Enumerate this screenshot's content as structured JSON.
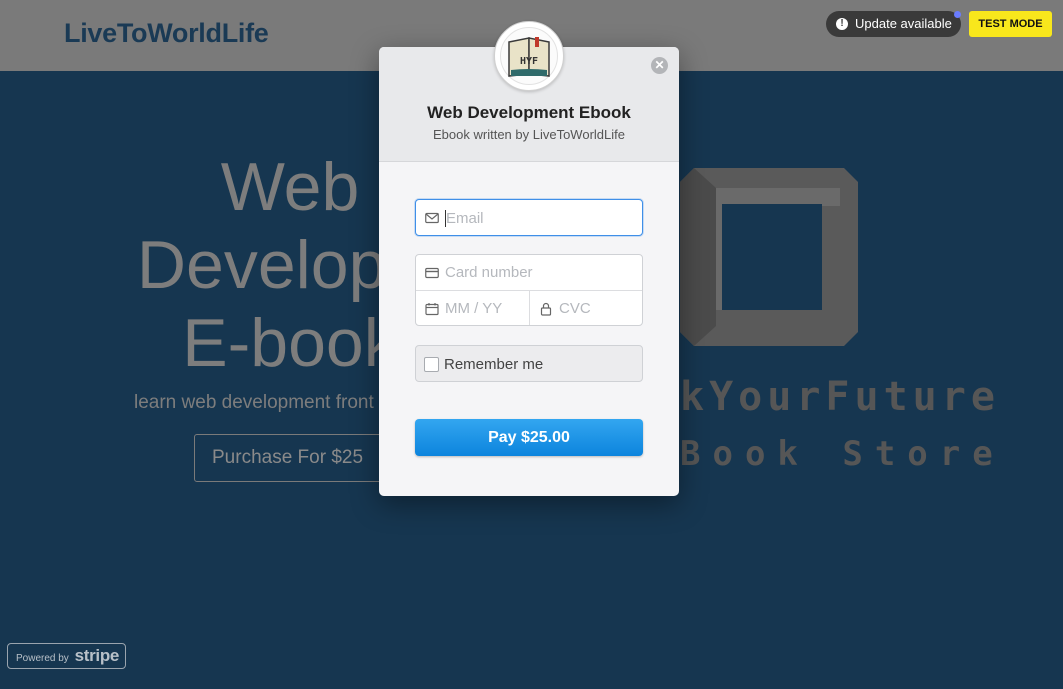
{
  "site": {
    "brand": "LiveToWorldLife",
    "hero_lines": [
      "Web",
      "Developm",
      "E-book"
    ],
    "hero_subtitle": "learn web development front",
    "purchase_label": "Purchase For $25",
    "store_line1": "kYourFuture",
    "store_line2": "Book Store"
  },
  "badges": {
    "update_label": "Update available",
    "test_mode_label": "TEST MODE"
  },
  "powered_by": {
    "prefix": "Powered by",
    "brand": "stripe"
  },
  "checkout": {
    "avatar_text": "HYF",
    "title": "Web Development Ebook",
    "subtitle": "Ebook written by LiveToWorldLife",
    "email_placeholder": "Email",
    "card_number_placeholder": "Card number",
    "expiry_placeholder": "MM / YY",
    "cvc_placeholder": "CVC",
    "remember_label": "Remember me",
    "pay_label": "Pay $25.00"
  },
  "icons": {
    "update": "exclamation-circle-icon",
    "close": "close-icon",
    "email": "envelope-icon",
    "card": "credit-card-icon",
    "expiry": "calendar-icon",
    "cvc": "lock-icon"
  },
  "colors": {
    "page_bg": "#163650",
    "pay_button": "#1a94e6",
    "focus_border": "#3f8fe8",
    "test_mode": "#f8e71c"
  }
}
